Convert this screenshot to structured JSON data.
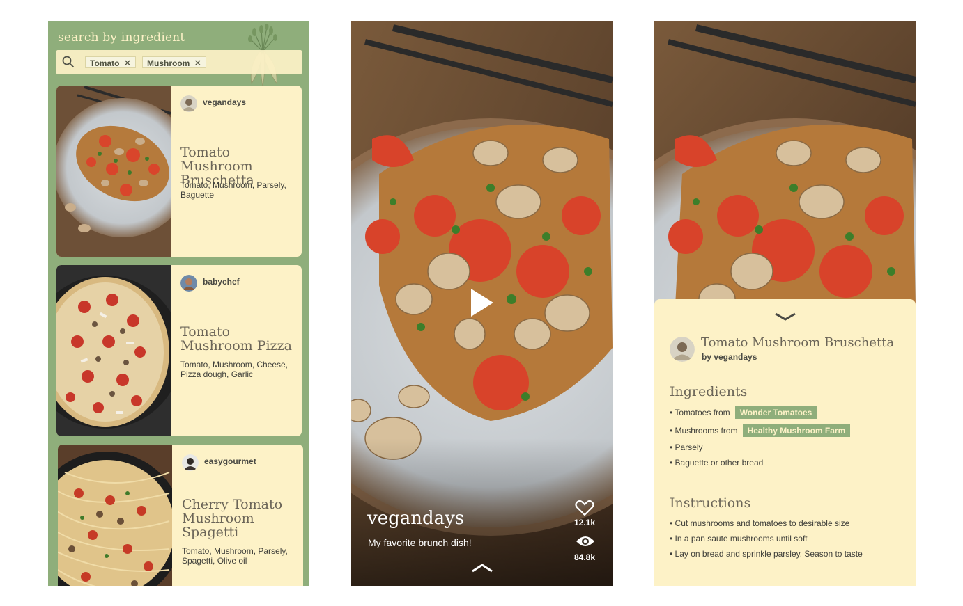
{
  "search": {
    "title": "search by ingredient",
    "chips": [
      {
        "label": "Tomato"
      },
      {
        "label": "Mushroom"
      }
    ],
    "chip_close": "✕"
  },
  "results": [
    {
      "user": "vegandays",
      "title": "Tomato Mushroom Bruschetta",
      "ingredients": "Tomato, Mushroom, Parsely, Baguette"
    },
    {
      "user": "babychef",
      "title": "Tomato Mushroom Pizza",
      "ingredients": "Tomato, Mushroom, Cheese, Pizza dough, Garlic"
    },
    {
      "user": "easygourmet",
      "title": "Cherry Tomato Mushroom Spagetti",
      "ingredients": "Tomato, Mushroom, Parsely, Spagetti, Olive oil"
    }
  ],
  "video": {
    "user": "vegandays",
    "caption": "My favorite brunch dish!",
    "likes": "12.1k",
    "views": "84.8k"
  },
  "detail": {
    "title": "Tomato Mushroom Bruschetta",
    "by": "by vegandays",
    "ingredients_heading": "Ingredients",
    "ingredients": [
      {
        "text": "• Tomatoes from",
        "tag": "Wonder Tomatoes"
      },
      {
        "text": "• Mushrooms from",
        "tag": "Healthy Mushroom Farm"
      },
      {
        "text": "• Parsely"
      },
      {
        "text": "• Baguette or other bread"
      }
    ],
    "instructions_heading": "Instructions",
    "instructions": [
      "• Cut mushrooms and tomatoes to desirable size",
      "• In a pan saute mushrooms until soft",
      "• Lay on bread and sprinkle parsley. Season to taste"
    ]
  },
  "colors": {
    "green": "#8fae7b",
    "cream": "#fdf2c7",
    "title_text": "#6b6558"
  }
}
